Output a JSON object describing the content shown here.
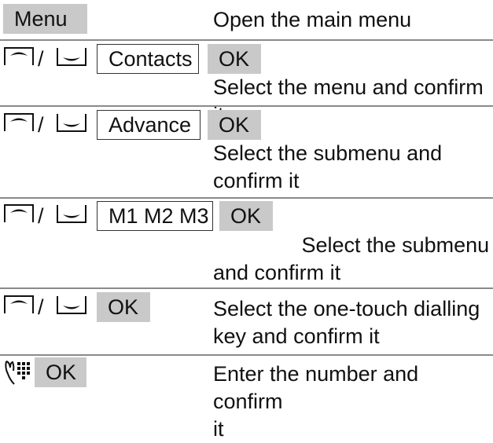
{
  "icons": {
    "nav_up": "nav-up-icon",
    "nav_down": "nav-down-icon",
    "keypad": "keypad-hand-icon"
  },
  "separator_slash": "/",
  "steps": [
    {
      "key": "Menu",
      "desc": "Open the main menu"
    },
    {
      "choice": "Contacts",
      "ok": "OK",
      "desc": "Select the menu and confirm it"
    },
    {
      "choice": "Advance",
      "ok": "OK",
      "desc": "Select the submenu and\nconfirm it"
    },
    {
      "choice": "M1 M2 M3",
      "ok": "OK",
      "desc": "               Select the submenu\nand confirm it"
    },
    {
      "ok": "OK",
      "desc": "Select the one-touch dialling\nkey and confirm it"
    },
    {
      "ok": "OK",
      "desc": "Enter the number and confirm\nit"
    }
  ],
  "colors": {
    "key_grey": "#c9c9c9",
    "separator": "#8a8a8a"
  }
}
